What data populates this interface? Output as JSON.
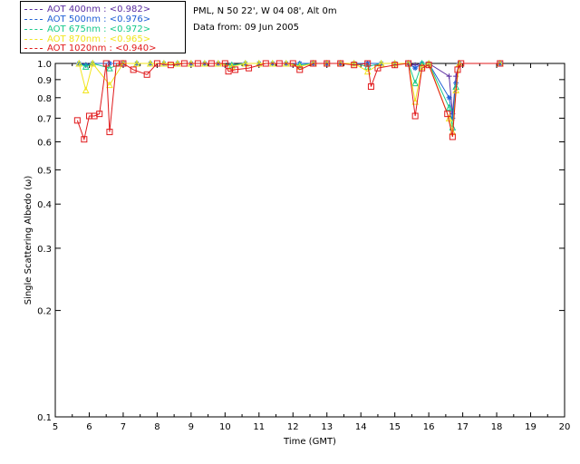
{
  "header": {
    "site_line": "PML, N 50 22', W 04 08', Alt 0m",
    "date_line": "Data from: 09 Jun 2005"
  },
  "legend": [
    {
      "label": "AOT  400nm : <0.982>",
      "color": "#5a2da0"
    },
    {
      "label": "AOT  500nm : <0.976>",
      "color": "#1f5fd6"
    },
    {
      "label": "AOT  675nm : <0.972>",
      "color": "#17c98a"
    },
    {
      "label": "AOT  870nm : <0.965>",
      "color": "#f2e51e"
    },
    {
      "label": "AOT 1020nm : <0.940>",
      "color": "#e0191b"
    }
  ],
  "chart_data": {
    "type": "line",
    "xlabel": "Time (GMT)",
    "ylabel": "Single Scattering Albedo (ω)",
    "xlim": [
      5,
      20
    ],
    "ylim": [
      0.1,
      1.0
    ],
    "yscale": "log",
    "x_ticks": [
      "5",
      "6",
      "7",
      "8",
      "9",
      "10",
      "11",
      "12",
      "13",
      "14",
      "15",
      "16",
      "17",
      "18",
      "19",
      "20"
    ],
    "y_ticks": [
      {
        "value": 1.0,
        "label": "1.0"
      },
      {
        "value": 0.9,
        "label": "0.9"
      },
      {
        "value": 0.8,
        "label": "0.8"
      },
      {
        "value": 0.7,
        "label": "0.7"
      },
      {
        "value": 0.6,
        "label": "0.6"
      },
      {
        "value": 0.5,
        "label": "0.5"
      },
      {
        "value": 0.4,
        "label": "0.4"
      },
      {
        "value": 0.3,
        "label": "0.3"
      },
      {
        "value": 0.2,
        "label": "0.2"
      },
      {
        "value": 0.1,
        "label": "0.1"
      }
    ],
    "legend_position": "top-left, outside plot",
    "series": [
      {
        "name": "AOT  400nm",
        "color": "#5a2da0",
        "marker": "plus",
        "points": [
          [
            5.7,
            1.0
          ],
          [
            5.9,
            0.99
          ],
          [
            6.1,
            1.0
          ],
          [
            6.6,
            1.0
          ],
          [
            7.0,
            1.0
          ],
          [
            7.4,
            1.0
          ],
          [
            7.8,
            1.0
          ],
          [
            8.2,
            1.0
          ],
          [
            8.6,
            1.0
          ],
          [
            9.0,
            1.0
          ],
          [
            9.4,
            1.0
          ],
          [
            9.8,
            1.0
          ],
          [
            10.2,
            0.99
          ],
          [
            10.6,
            1.0
          ],
          [
            11.0,
            1.0
          ],
          [
            11.4,
            1.0
          ],
          [
            11.8,
            1.0
          ],
          [
            12.2,
            1.0
          ],
          [
            12.6,
            1.0
          ],
          [
            13.0,
            1.0
          ],
          [
            13.4,
            1.0
          ],
          [
            13.8,
            1.0
          ],
          [
            14.2,
            1.0
          ],
          [
            14.6,
            1.0
          ],
          [
            15.0,
            1.0
          ],
          [
            15.4,
            1.0
          ],
          [
            15.6,
            0.99
          ],
          [
            15.8,
            1.0
          ],
          [
            16.0,
            1.0
          ],
          [
            16.6,
            0.92
          ],
          [
            16.7,
            0.72
          ],
          [
            16.8,
            0.92
          ],
          [
            16.9,
            1.0
          ],
          [
            18.1,
            1.0
          ]
        ]
      },
      {
        "name": "AOT  500nm",
        "color": "#1f5fd6",
        "marker": "asterisk",
        "points": [
          [
            5.7,
            1.0
          ],
          [
            5.9,
            0.99
          ],
          [
            6.1,
            1.0
          ],
          [
            6.6,
            1.0
          ],
          [
            7.0,
            1.0
          ],
          [
            7.4,
            1.0
          ],
          [
            7.8,
            1.0
          ],
          [
            8.2,
            1.0
          ],
          [
            8.6,
            1.0
          ],
          [
            9.0,
            1.0
          ],
          [
            9.4,
            1.0
          ],
          [
            9.8,
            1.0
          ],
          [
            10.2,
            0.99
          ],
          [
            10.6,
            1.0
          ],
          [
            11.0,
            1.0
          ],
          [
            11.4,
            1.0
          ],
          [
            11.8,
            1.0
          ],
          [
            12.2,
            1.0
          ],
          [
            12.6,
            1.0
          ],
          [
            13.0,
            1.0
          ],
          [
            13.4,
            1.0
          ],
          [
            13.8,
            1.0
          ],
          [
            14.2,
            1.0
          ],
          [
            14.6,
            1.0
          ],
          [
            15.0,
            1.0
          ],
          [
            15.4,
            1.0
          ],
          [
            15.6,
            0.97
          ],
          [
            15.8,
            1.0
          ],
          [
            16.0,
            1.0
          ],
          [
            16.6,
            0.8
          ],
          [
            16.7,
            0.7
          ],
          [
            16.8,
            0.88
          ],
          [
            16.9,
            1.0
          ],
          [
            18.1,
            1.0
          ]
        ]
      },
      {
        "name": "AOT  675nm",
        "color": "#17c98a",
        "marker": "triangle",
        "points": [
          [
            5.7,
            1.0
          ],
          [
            5.9,
            0.98
          ],
          [
            6.1,
            1.0
          ],
          [
            6.6,
            0.97
          ],
          [
            7.0,
            1.0
          ],
          [
            7.4,
            1.0
          ],
          [
            7.8,
            1.0
          ],
          [
            8.2,
            1.0
          ],
          [
            8.6,
            1.0
          ],
          [
            9.0,
            1.0
          ],
          [
            9.4,
            1.0
          ],
          [
            9.8,
            1.0
          ],
          [
            10.2,
            0.99
          ],
          [
            10.6,
            1.0
          ],
          [
            11.0,
            1.0
          ],
          [
            11.4,
            1.0
          ],
          [
            11.8,
            1.0
          ],
          [
            12.2,
            0.99
          ],
          [
            12.6,
            1.0
          ],
          [
            13.0,
            1.0
          ],
          [
            13.4,
            1.0
          ],
          [
            13.8,
            1.0
          ],
          [
            14.2,
            0.98
          ],
          [
            14.6,
            1.0
          ],
          [
            15.0,
            1.0
          ],
          [
            15.4,
            1.0
          ],
          [
            15.6,
            0.88
          ],
          [
            15.8,
            1.0
          ],
          [
            16.0,
            1.0
          ],
          [
            16.6,
            0.75
          ],
          [
            16.7,
            0.66
          ],
          [
            16.8,
            0.86
          ],
          [
            16.9,
            1.0
          ],
          [
            18.1,
            1.0
          ]
        ]
      },
      {
        "name": "AOT  870nm",
        "color": "#f2e51e",
        "marker": "triangle",
        "points": [
          [
            5.7,
            1.0
          ],
          [
            5.9,
            0.84
          ],
          [
            6.1,
            1.0
          ],
          [
            6.6,
            0.87
          ],
          [
            7.0,
            1.0
          ],
          [
            7.4,
            1.0
          ],
          [
            7.8,
            1.0
          ],
          [
            8.2,
            1.0
          ],
          [
            8.6,
            1.0
          ],
          [
            9.0,
            1.0
          ],
          [
            9.4,
            1.0
          ],
          [
            9.8,
            1.0
          ],
          [
            10.2,
            0.98
          ],
          [
            10.6,
            1.0
          ],
          [
            11.0,
            1.0
          ],
          [
            11.4,
            1.0
          ],
          [
            11.8,
            1.0
          ],
          [
            12.2,
            0.98
          ],
          [
            12.6,
            1.0
          ],
          [
            13.0,
            1.0
          ],
          [
            13.4,
            1.0
          ],
          [
            13.8,
            1.0
          ],
          [
            14.2,
            0.95
          ],
          [
            14.6,
            1.0
          ],
          [
            15.0,
            1.0
          ],
          [
            15.4,
            1.0
          ],
          [
            15.6,
            0.78
          ],
          [
            15.8,
            0.98
          ],
          [
            16.0,
            1.0
          ],
          [
            16.6,
            0.7
          ],
          [
            16.7,
            0.64
          ],
          [
            16.8,
            0.84
          ],
          [
            16.9,
            1.0
          ],
          [
            18.1,
            1.0
          ]
        ]
      },
      {
        "name": "AOT 1020nm",
        "color": "#e0191b",
        "marker": "square",
        "points": [
          [
            5.65,
            0.69
          ],
          [
            5.85,
            0.61
          ],
          [
            6.0,
            0.71
          ],
          [
            6.15,
            0.71
          ],
          [
            6.3,
            0.72
          ],
          [
            6.5,
            1.0
          ],
          [
            6.6,
            0.64
          ],
          [
            6.8,
            1.0
          ],
          [
            7.0,
            1.0
          ],
          [
            7.3,
            0.96
          ],
          [
            7.7,
            0.93
          ],
          [
            8.0,
            1.0
          ],
          [
            8.4,
            0.99
          ],
          [
            8.8,
            1.0
          ],
          [
            9.2,
            1.0
          ],
          [
            9.6,
            1.0
          ],
          [
            10.0,
            1.0
          ],
          [
            10.1,
            0.95
          ],
          [
            10.3,
            0.96
          ],
          [
            10.7,
            0.97
          ],
          [
            11.2,
            1.0
          ],
          [
            11.6,
            1.0
          ],
          [
            12.0,
            1.0
          ],
          [
            12.2,
            0.96
          ],
          [
            12.6,
            1.0
          ],
          [
            13.0,
            1.0
          ],
          [
            13.4,
            1.0
          ],
          [
            13.8,
            0.99
          ],
          [
            14.2,
            1.0
          ],
          [
            14.3,
            0.86
          ],
          [
            14.5,
            0.97
          ],
          [
            15.0,
            0.99
          ],
          [
            15.4,
            1.0
          ],
          [
            15.6,
            0.71
          ],
          [
            15.8,
            0.97
          ],
          [
            16.0,
            0.99
          ],
          [
            16.55,
            0.72
          ],
          [
            16.7,
            0.62
          ],
          [
            16.85,
            0.96
          ],
          [
            16.95,
            1.0
          ],
          [
            18.1,
            1.0
          ]
        ]
      }
    ]
  }
}
